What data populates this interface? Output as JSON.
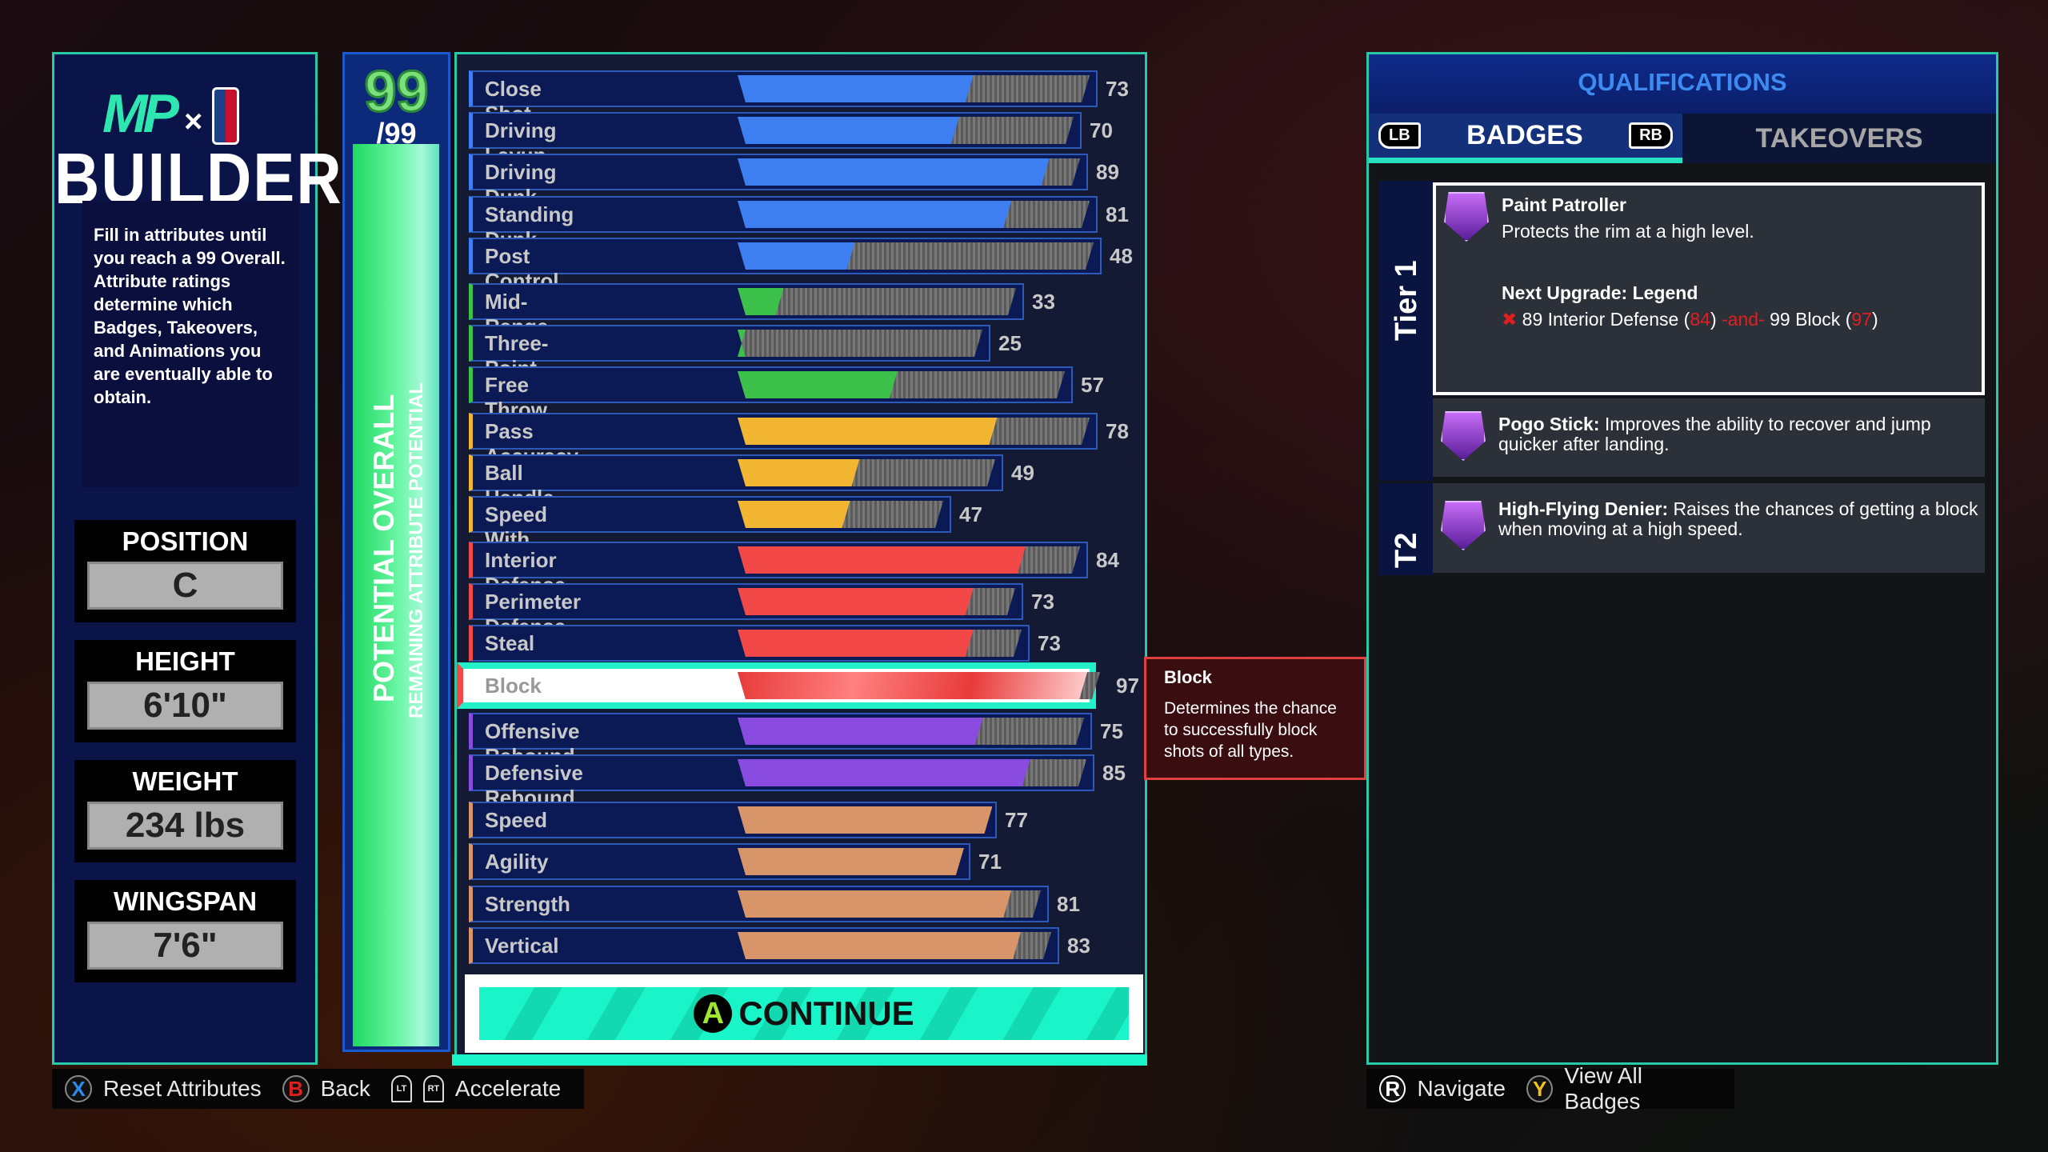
{
  "left": {
    "logo_text": "MP x NBA",
    "title": "BUILDER",
    "description": "Fill in attributes until you reach a 99 Overall. Attribute ratings determine which Badges, Takeovers, and Animations you are eventually able to obtain.",
    "stats": [
      {
        "label": "POSITION",
        "value": "C"
      },
      {
        "label": "HEIGHT",
        "value": "6'10\""
      },
      {
        "label": "WEIGHT",
        "value": "234 lbs"
      },
      {
        "label": "WINGSPAN",
        "value": "7'6\""
      }
    ]
  },
  "potential": {
    "overall": "99",
    "max": "/99",
    "label_overall": "POTENTIAL OVERALL",
    "label_remaining": "REMAINING ATTRIBUTE POTENTIAL"
  },
  "colors": {
    "finishing": "#3d7ef0",
    "shooting": "#3cc24a",
    "playmaking": "#f2b632",
    "defense": "#f24848",
    "rebounding": "#8a4ce0",
    "physicals": "#d9956a",
    "accent": "#19f5c9"
  },
  "attributes": [
    {
      "name": "Close Shot",
      "value": 73,
      "group": "finishing"
    },
    {
      "name": "Driving Layup",
      "value": 70,
      "group": "finishing"
    },
    {
      "name": "Driving Dunk",
      "value": 89,
      "group": "finishing"
    },
    {
      "name": "Standing Dunk",
      "value": 81,
      "group": "finishing"
    },
    {
      "name": "Post Control",
      "value": 48,
      "group": "finishing"
    },
    {
      "name": "Mid-Range Shot",
      "value": 33,
      "group": "shooting"
    },
    {
      "name": "Three-Point Shot",
      "value": 25,
      "group": "shooting"
    },
    {
      "name": "Free Throw",
      "value": 57,
      "group": "shooting"
    },
    {
      "name": "Pass Accuracy",
      "value": 78,
      "group": "playmaking"
    },
    {
      "name": "Ball Handle",
      "value": 49,
      "group": "playmaking"
    },
    {
      "name": "Speed With Ball",
      "value": 47,
      "group": "playmaking"
    },
    {
      "name": "Interior Defense",
      "value": 84,
      "group": "defense"
    },
    {
      "name": "Perimeter Defense",
      "value": 73,
      "group": "defense"
    },
    {
      "name": "Steal",
      "value": 73,
      "group": "defense"
    },
    {
      "name": "Block",
      "value": 97,
      "group": "defense",
      "selected": true
    },
    {
      "name": "Offensive Rebound",
      "value": 75,
      "group": "rebounding"
    },
    {
      "name": "Defensive Rebound",
      "value": 85,
      "group": "rebounding"
    },
    {
      "name": "Speed",
      "value": 77,
      "group": "physicals"
    },
    {
      "name": "Agility",
      "value": 71,
      "group": "physicals"
    },
    {
      "name": "Strength",
      "value": 81,
      "group": "physicals"
    },
    {
      "name": "Vertical",
      "value": 83,
      "group": "physicals"
    }
  ],
  "continue": {
    "button_glyph": "A",
    "label": "CONTINUE"
  },
  "tooltip": {
    "title": "Block",
    "text": "Determines the chance to successfully block shots of all types."
  },
  "qualifications": {
    "title": "QUALIFICATIONS",
    "tabs": [
      {
        "label": "BADGES",
        "active": true
      },
      {
        "label": "TAKEOVERS",
        "active": false
      }
    ],
    "lb": "LB",
    "rb": "RB",
    "tier1": "Tier 1",
    "tier2": "T2",
    "featured": {
      "name": "Paint Patroller",
      "desc": "Protects the rim at a high level.",
      "next": "Next Upgrade: Legend",
      "req_a": "89 Interior Defense (",
      "req_a_val": "84",
      "req_join": "-and-",
      "req_b": "99 Block (",
      "req_b_val": "97",
      "close": ")"
    },
    "badges": [
      {
        "name": "Pogo Stick:",
        "desc": "Improves the ability to recover and jump quicker after landing."
      },
      {
        "name": "High-Flying Denier:",
        "desc": "Raises the chances of getting a block when moving at a high speed."
      }
    ]
  },
  "footer_left": [
    {
      "glyph": "X",
      "label": "Reset Attributes"
    },
    {
      "glyph": "B",
      "label": "Back"
    },
    {
      "glyph_lt": "LT",
      "glyph_rt": "RT",
      "label": "Accelerate"
    }
  ],
  "footer_right": [
    {
      "glyph": "R",
      "label": "Navigate"
    },
    {
      "glyph": "Y",
      "label": "View All Badges"
    }
  ]
}
